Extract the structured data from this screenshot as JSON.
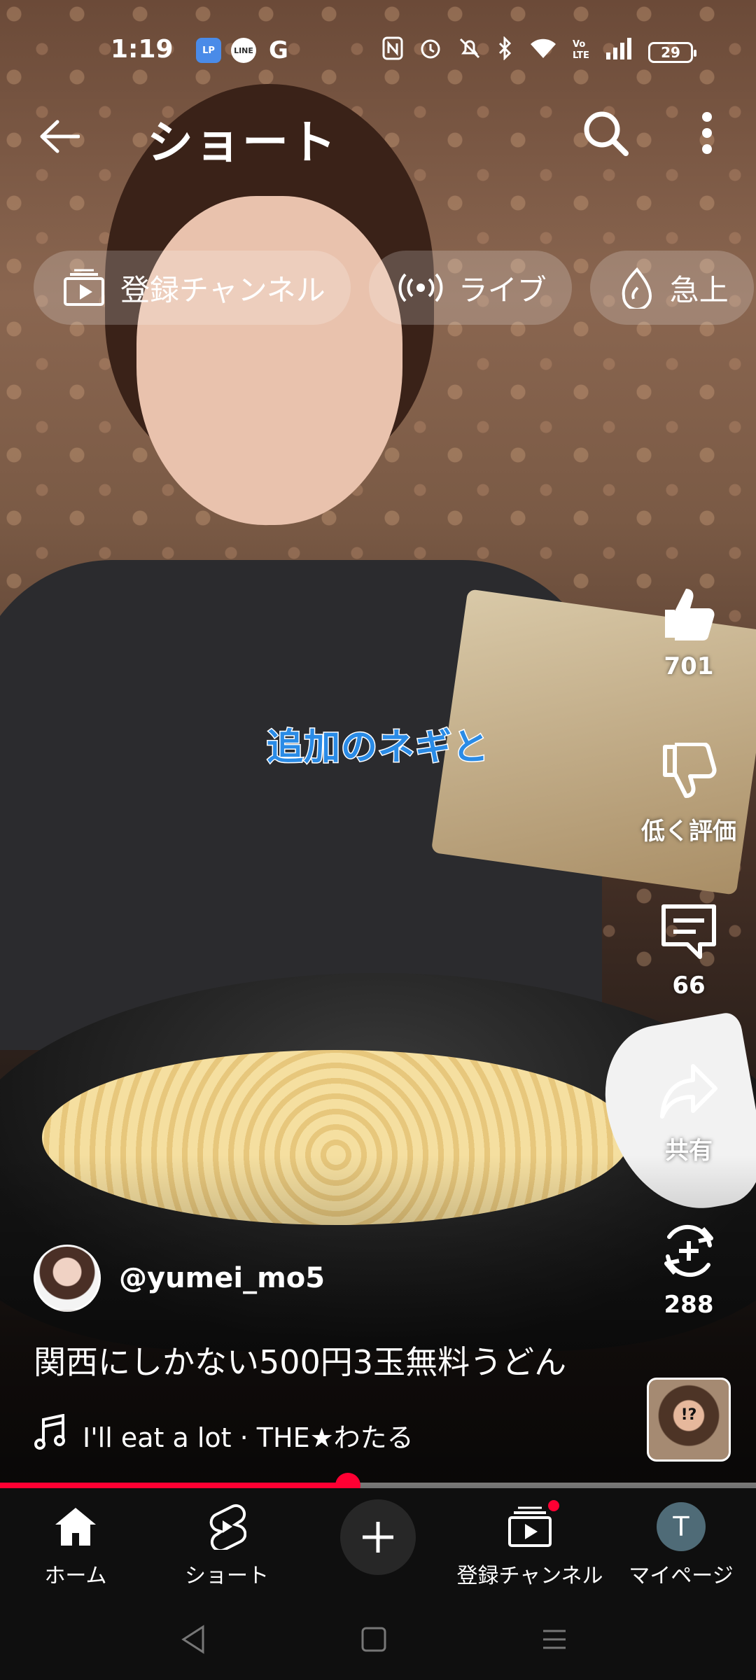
{
  "status_bar": {
    "time": "1:19",
    "apps": [
      "LP",
      "LINE",
      "G"
    ],
    "battery": "29"
  },
  "header": {
    "title": "ショート",
    "icons": [
      "arrow-left-icon",
      "search-icon",
      "more-vert-icon"
    ]
  },
  "chips": [
    {
      "label": "登録チャンネル",
      "icon": "subscriptions-icon"
    },
    {
      "label": "ライブ",
      "icon": "live-icon"
    },
    {
      "label": "急上",
      "icon": "trending-icon"
    }
  ],
  "video": {
    "caption": "追加のネギと",
    "channel_handle": "@yumei_mo5",
    "title": "関西にしかない500円3玉無料うどん",
    "music": "I'll eat a lot · THE★わたる",
    "progress": 0.46,
    "thumb_text": "!?"
  },
  "actions": {
    "like_count": "701",
    "dislike_label": "低く評価",
    "comment_count": "66",
    "share_label": "共有",
    "remix_count": "288"
  },
  "bottom_nav": {
    "home": "ホーム",
    "shorts": "ショート",
    "subscriptions": "登録チャンネル",
    "mypage": "マイページ",
    "user_initial": "T"
  },
  "colors": {
    "accent": "#ff0033",
    "caption_text": "#2a8be6",
    "nav_background": "#0f0f0f"
  }
}
